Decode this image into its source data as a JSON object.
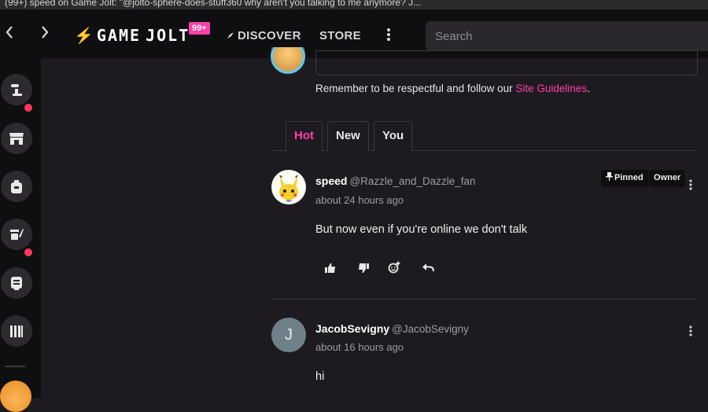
{
  "window": {
    "title": "(99+) speed on Game Jolt: \"@jolto-sphere-does-stuff360 why aren't you talking to me anymore? J..."
  },
  "topbar": {
    "back_icon": "chevron-left-icon",
    "forward_icon": "chevron-right-icon",
    "logo_bolt": "⚡",
    "logo_text_1": "GAME",
    "logo_text_2": "JOLT",
    "notification_count": "99+",
    "discover_label": "DISCOVER",
    "discover_icon": "compass-icon",
    "store_label": "STORE",
    "more_icon": "vertical-dots-icon",
    "search_placeholder": "Search"
  },
  "sidebar": {
    "items": [
      {
        "icon": "activity-feed-icon",
        "has_dot": true
      },
      {
        "icon": "store-icon",
        "has_dot": false
      },
      {
        "icon": "backpack-icon",
        "has_dot": false
      },
      {
        "icon": "quests-icon",
        "has_dot": true
      },
      {
        "icon": "chat-icon",
        "has_dot": false
      },
      {
        "icon": "library-icon",
        "has_dot": false
      }
    ],
    "accent_dot_color": "#ff3a5a"
  },
  "composer": {
    "guidelines_text": "Remember to be respectful and follow our ",
    "guidelines_link": "Site Guidelines",
    "guidelines_end": "."
  },
  "tabs": [
    {
      "label": "Hot",
      "active": true
    },
    {
      "label": "New",
      "active": false
    },
    {
      "label": "You",
      "active": false
    }
  ],
  "comments": [
    {
      "name": "speed",
      "handle": "@Razzle_and_Dazzle_fan",
      "time": "about 24 hours ago",
      "body": "But now even if you're online we don't talk",
      "pinned_label": "Pinned",
      "owner_label": "Owner",
      "avatar_icon": "pikachu-avatar"
    },
    {
      "name": "JacobSevigny",
      "handle": "@JacobSevigny",
      "time": "about 16 hours ago",
      "body": "hi",
      "avatar_letter": "J"
    }
  ],
  "colors": {
    "accent": "#ff3fac",
    "background": "#1e1b20",
    "topbar": "#0f0e10"
  }
}
